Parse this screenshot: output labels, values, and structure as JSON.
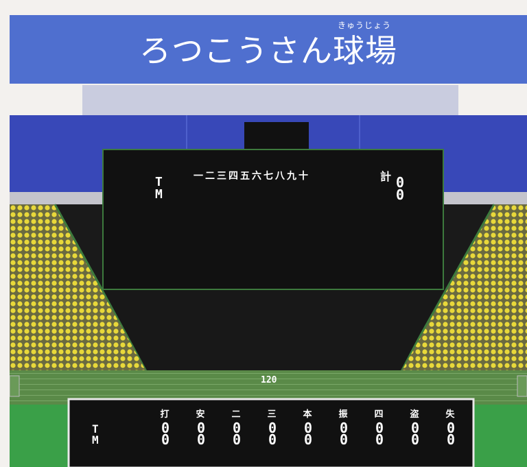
{
  "banner": {
    "title": "ろつこうさん球場",
    "ruby": "きゅうじょう"
  },
  "scoreboard": {
    "innings_header": "一二三四五六七八九十",
    "total_label": "計",
    "teams": [
      "T",
      "M"
    ],
    "totals": [
      "0",
      "0"
    ]
  },
  "field": {
    "distance": "120"
  },
  "stats_board": {
    "teams": [
      "T",
      "M"
    ],
    "columns": [
      {
        "label": "打",
        "values": [
          "0",
          "0"
        ]
      },
      {
        "label": "安",
        "values": [
          "0",
          "0"
        ]
      },
      {
        "label": "二",
        "values": [
          "0",
          "0"
        ]
      },
      {
        "label": "三",
        "values": [
          "0",
          "0"
        ]
      },
      {
        "label": "本",
        "values": [
          "0",
          "0"
        ]
      },
      {
        "label": "振",
        "values": [
          "0",
          "0"
        ]
      },
      {
        "label": "四",
        "values": [
          "0",
          "0"
        ]
      },
      {
        "label": "盗",
        "values": [
          "0",
          "0"
        ]
      },
      {
        "label": "失",
        "values": [
          "0",
          "0"
        ]
      }
    ]
  },
  "colors": {
    "banner": "#4f6fcf",
    "sky_stands": "#3848b8",
    "crowd_yellow": "#e8d83a",
    "field_green": "#3aa048",
    "wall_green": "#5a8a48",
    "board_black": "#111111"
  }
}
